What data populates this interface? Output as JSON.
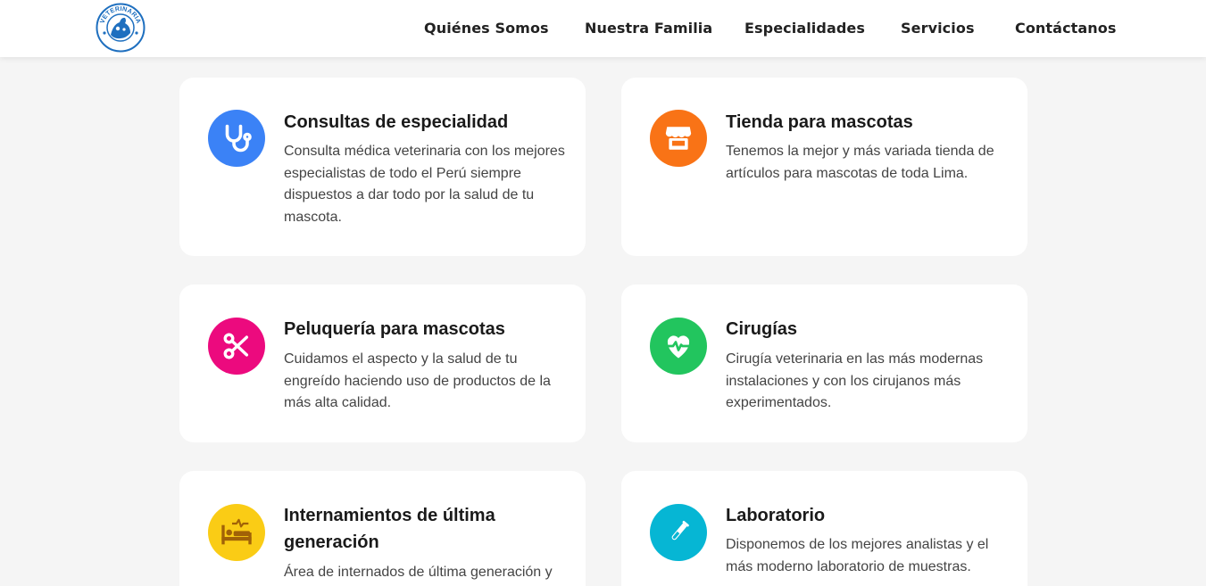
{
  "brand": {
    "logo_text": "VETERINARIA",
    "logo_color": "#1e6fbf"
  },
  "nav": {
    "items": [
      {
        "label": "Quiénes Somos"
      },
      {
        "label": "Nuestra Familia"
      },
      {
        "label": "Especialidades"
      },
      {
        "label": "Servicios"
      },
      {
        "label": "Contáctanos"
      }
    ]
  },
  "services": [
    {
      "icon": "stethoscope-icon",
      "color": "#3b82f6",
      "title": "Consultas de especialidad",
      "description": "Consulta médica veterinaria con los mejores especialistas de todo el Perú siempre dispuestos a dar todo por la salud de tu mascota."
    },
    {
      "icon": "store-icon",
      "color": "#f97316",
      "title": "Tienda para mascotas",
      "description": "Tenemos la mejor y más variada tienda de artículos para mascotas de toda Lima."
    },
    {
      "icon": "scissors-icon",
      "color": "#ec0a7e",
      "title": "Peluquería para mascotas",
      "description": "Cuidamos el aspecto y la salud de tu engreído haciendo uso de productos de la más alta calidad."
    },
    {
      "icon": "heart-pulse-icon",
      "color": "#22c55e",
      "title": "Cirugías",
      "description": "Cirugía veterinaria en las más modernas instalaciones y con los cirujanos más experimentados."
    },
    {
      "icon": "hospital-bed-icon",
      "color": "#facc15",
      "title": "Internamientos de última generación",
      "description": "Área de internados de última generación y"
    },
    {
      "icon": "test-tube-icon",
      "color": "#06b6d4",
      "title": "Laboratorio",
      "description": "Disponemos de los mejores analistas y el más moderno laboratorio de muestras."
    }
  ]
}
